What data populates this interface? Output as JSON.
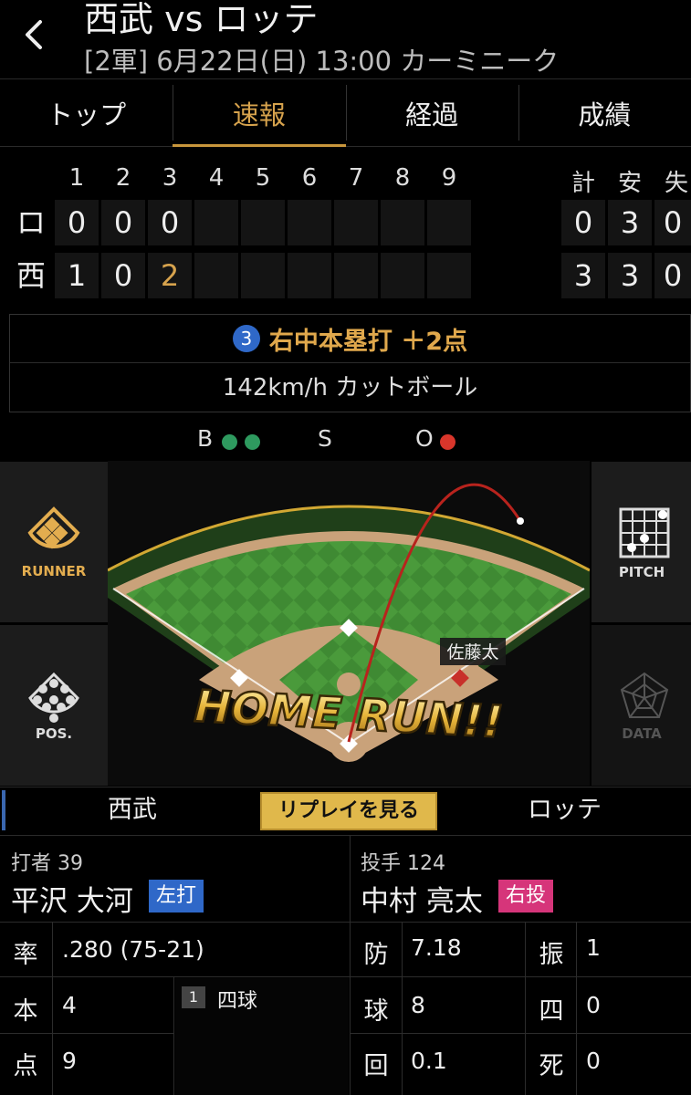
{
  "header": {
    "title": "西武 vs ロッテ",
    "subtitle": "[2軍] 6月22日(日) 13:00 カーミニーク"
  },
  "tabs": [
    {
      "label": "トップ",
      "active": false
    },
    {
      "label": "速報",
      "active": true
    },
    {
      "label": "経過",
      "active": false
    },
    {
      "label": "成績",
      "active": false
    }
  ],
  "scoreboard": {
    "innings": [
      "1",
      "2",
      "3",
      "4",
      "5",
      "6",
      "7",
      "8",
      "9"
    ],
    "totals_headers": [
      "計",
      "安",
      "失"
    ],
    "teams": [
      {
        "label": "ロ",
        "scores": [
          "0",
          "0",
          "0",
          "",
          "",
          "",
          "",
          "",
          ""
        ],
        "totals": [
          "0",
          "3",
          "0"
        ]
      },
      {
        "label": "西",
        "scores": [
          "1",
          "0",
          "2",
          "",
          "",
          "",
          "",
          "",
          ""
        ],
        "totals": [
          "3",
          "3",
          "0"
        ]
      }
    ]
  },
  "play": {
    "inning": "3",
    "result": "右中本塁打 ＋2点",
    "pitch": "142km/h カットボール"
  },
  "count": {
    "b_label": "B",
    "s_label": "S",
    "o_label": "O",
    "balls": 2,
    "strikes": 0,
    "outs": 1
  },
  "panels": {
    "runner": "RUNNER",
    "pos": "POS.",
    "pitch": "PITCH",
    "data": "DATA"
  },
  "field": {
    "fielder_label": "佐藤太",
    "banner": "HOME RUN!!"
  },
  "bottom": {
    "home_team": "西武",
    "away_team": "ロッテ",
    "replay_button": "リプレイを見る"
  },
  "batter": {
    "role": "打者",
    "number": "39",
    "name": "平沢 大河",
    "hand": "左打",
    "stats": [
      {
        "key": "率",
        "value": ".280 (75-21)"
      },
      {
        "key": "本",
        "value": "4"
      },
      {
        "key": "点",
        "value": "9"
      }
    ],
    "pa_index": "1",
    "pa_result": "四球"
  },
  "pitcher": {
    "role": "投手",
    "number": "124",
    "name": "中村 亮太",
    "hand": "右投",
    "stats": [
      {
        "key": "防",
        "value": "7.18"
      },
      {
        "key": "球",
        "value": "8"
      },
      {
        "key": "回",
        "value": "0.1"
      },
      {
        "key": "振",
        "value": "1"
      },
      {
        "key": "四",
        "value": "0"
      },
      {
        "key": "死",
        "value": "0"
      }
    ]
  },
  "colors": {
    "accent": "#d7a34d",
    "ball_dot": "#2e9a5f",
    "out_dot": "#d9362b",
    "inning_badge": "#2f68c8",
    "batter_tag": "#2f68c8",
    "pitcher_tag": "#d6357a"
  },
  "icons": [
    "back-arrow-icon",
    "runner-diamond-icon",
    "positions-icon",
    "pitch-grid-icon",
    "data-radar-icon"
  ]
}
